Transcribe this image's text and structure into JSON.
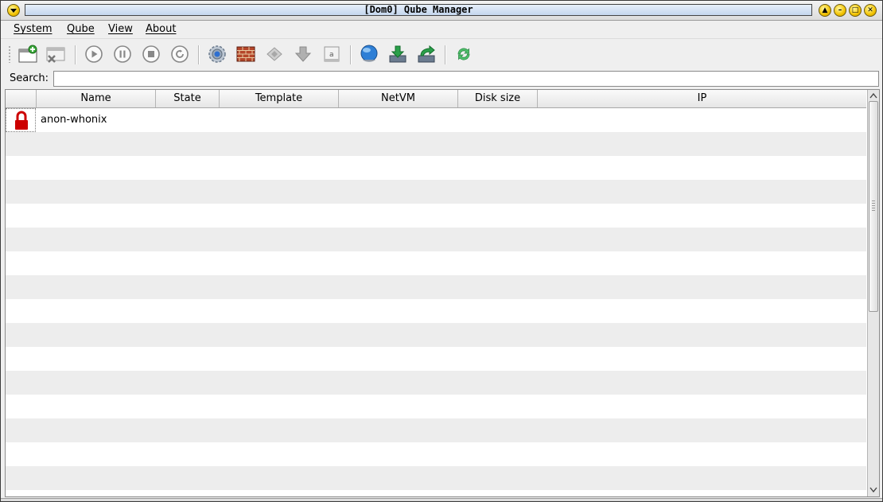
{
  "window": {
    "title": "[Dom0] Qube Manager"
  },
  "menubar": {
    "items": [
      {
        "label": "System"
      },
      {
        "label": "Qube"
      },
      {
        "label": "View"
      },
      {
        "label": "About"
      }
    ]
  },
  "toolbar": {
    "icons": [
      "create-qube-icon",
      "delete-qube-icon",
      "start-icon",
      "pause-icon",
      "shutdown-icon",
      "restart-icon",
      "settings-icon",
      "firewall-icon",
      "update-icon",
      "install-icon",
      "logs-icon",
      "global-settings-icon",
      "backup-icon",
      "restore-icon",
      "refresh-icon"
    ]
  },
  "search": {
    "label": "Search:",
    "value": "",
    "placeholder": ""
  },
  "table": {
    "columns": [
      "",
      "Name",
      "State",
      "Template",
      "NetVM",
      "Disk size",
      "IP"
    ],
    "rows": [
      {
        "icon": "padlock-icon",
        "name": "anon-whonix",
        "state": "",
        "template": "",
        "netvm": "",
        "disk_size": "",
        "ip": ""
      }
    ]
  },
  "colors": {
    "padlock": "#cc0000",
    "row_alt": "#ededed",
    "title_field": "#c4d6ee"
  }
}
